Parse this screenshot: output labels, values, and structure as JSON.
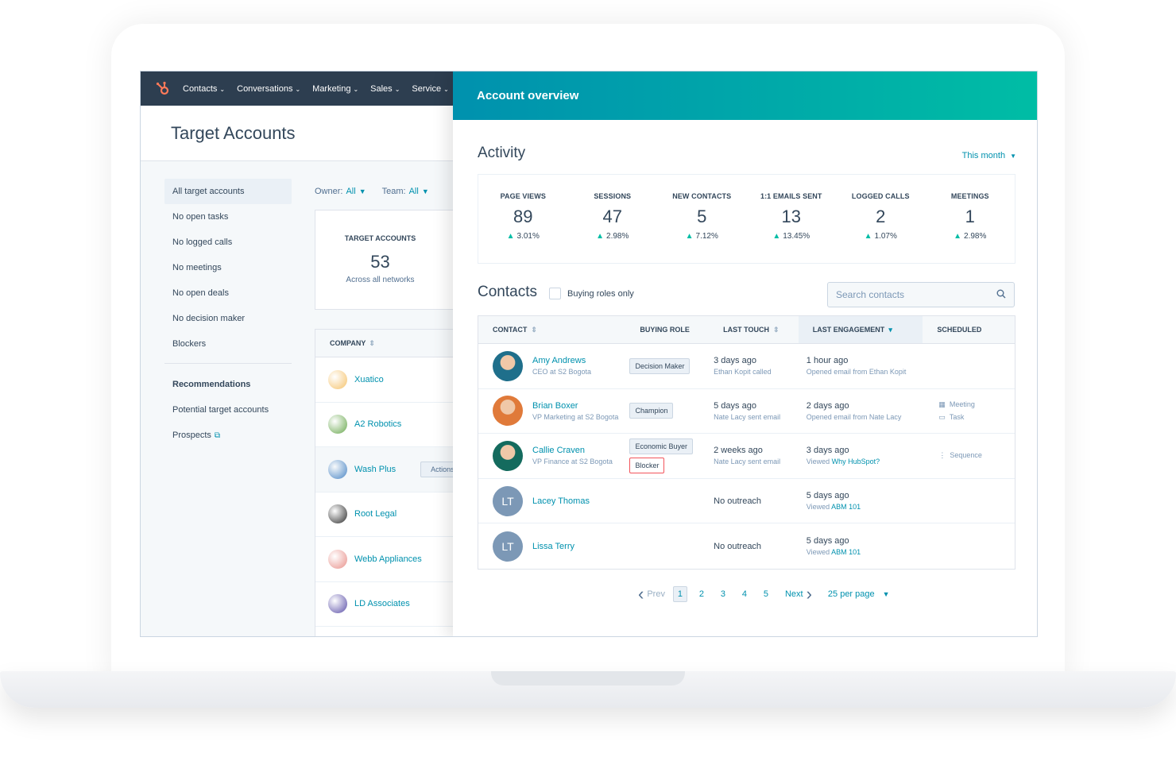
{
  "nav": {
    "items": [
      {
        "label": "Contacts"
      },
      {
        "label": "Conversations"
      },
      {
        "label": "Marketing"
      },
      {
        "label": "Sales"
      },
      {
        "label": "Service"
      }
    ]
  },
  "left": {
    "title": "Target Accounts",
    "sidebar": [
      "All target accounts",
      "No open tasks",
      "No logged calls",
      "No meetings",
      "No open deals",
      "No decision maker",
      "Blockers"
    ],
    "recommendations_header": "Recommendations",
    "recommendations": [
      "Potential target accounts",
      "Prospects"
    ],
    "filters": {
      "owner_label": "Owner:",
      "owner_value": "All",
      "team_label": "Team:",
      "team_value": "All"
    },
    "target_card": {
      "label": "TARGET ACCOUNTS",
      "value": "53",
      "sub": "Across all networks"
    },
    "company_header": "COMPANY",
    "companies": [
      {
        "name": "Xuatico",
        "color": "#f5c26b"
      },
      {
        "name": "A2 Robotics",
        "color": "#6aa84f"
      },
      {
        "name": "Wash Plus",
        "color": "#4a86c5"
      },
      {
        "name": "Root Legal",
        "color": "#2d2d2d"
      },
      {
        "name": "Webb Appliances",
        "color": "#e8908a"
      },
      {
        "name": "LD Associates",
        "color": "#5b4fa8"
      }
    ],
    "actions_label": "Actions"
  },
  "panel": {
    "title": "Account overview",
    "activity_title": "Activity",
    "timeframe": "This month",
    "stats": [
      {
        "label": "PAGE VIEWS",
        "value": "89",
        "change": "3.01%"
      },
      {
        "label": "SESSIONS",
        "value": "47",
        "change": "2.98%"
      },
      {
        "label": "NEW CONTACTS",
        "value": "5",
        "change": "7.12%"
      },
      {
        "label": "1:1 EMAILS SENT",
        "value": "13",
        "change": "13.45%"
      },
      {
        "label": "LOGGED CALLS",
        "value": "2",
        "change": "1.07%"
      },
      {
        "label": "MEETINGS",
        "value": "1",
        "change": "2.98%"
      }
    ],
    "contacts_title": "Contacts",
    "buying_roles_label": "Buying roles only",
    "search_placeholder": "Search contacts",
    "columns": {
      "contact": "CONTACT",
      "role": "BUYING ROLE",
      "touch": "LAST TOUCH",
      "engagement": "LAST ENGAGEMENT",
      "scheduled": "SCHEDULED"
    },
    "contacts": [
      {
        "name": "Amy Andrews",
        "title": "CEO at S2 Bogota",
        "avatar_color": "#1f6f8b",
        "roles": [
          "Decision Maker"
        ],
        "touch": "3 days ago",
        "touch_sub": "Ethan Kopit called",
        "engage": "1 hour ago",
        "engage_sub": "Opened email from Ethan Kopit",
        "engage_link": "",
        "scheduled": []
      },
      {
        "name": "Brian Boxer",
        "title": "VP Marketing at S2 Bogota",
        "avatar_color": "#e07a3a",
        "roles": [
          "Champion"
        ],
        "touch": "5 days ago",
        "touch_sub": "Nate Lacy sent email",
        "engage": "2 days ago",
        "engage_sub": "Opened email from Nate Lacy",
        "engage_link": "",
        "scheduled": [
          "Meeting",
          "Task"
        ]
      },
      {
        "name": "Callie Craven",
        "title": "VP Finance at S2 Bogota",
        "avatar_color": "#146b5e",
        "roles": [
          "Economic Buyer",
          "Blocker"
        ],
        "touch": "2 weeks ago",
        "touch_sub": "Nate Lacy sent email",
        "engage": "3 days ago",
        "engage_sub": "Viewed",
        "engage_link": "Why HubSpot?",
        "scheduled": [
          "Sequence"
        ]
      },
      {
        "name": "Lacey Thomas",
        "title": "",
        "avatar_color": "#7c98b6",
        "initials": "LT",
        "roles": [],
        "touch": "No outreach",
        "touch_sub": "",
        "engage": "5 days ago",
        "engage_sub": "Viewed",
        "engage_link": "ABM 101",
        "scheduled": []
      },
      {
        "name": "Lissa Terry",
        "title": "",
        "avatar_color": "#7c98b6",
        "initials": "LT",
        "roles": [],
        "touch": "No outreach",
        "touch_sub": "",
        "engage": "5 days ago",
        "engage_sub": "Viewed",
        "engage_link": "ABM 101",
        "scheduled": []
      }
    ],
    "pager": {
      "prev": "Prev",
      "pages": [
        "1",
        "2",
        "3",
        "4",
        "5"
      ],
      "current": "1",
      "next": "Next",
      "per_page": "25 per page"
    }
  }
}
